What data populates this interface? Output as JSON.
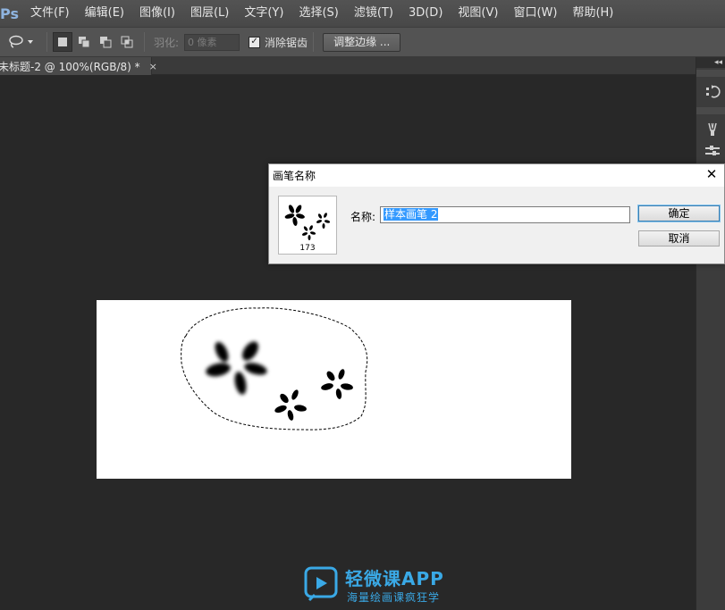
{
  "app": {
    "logo": "Ps"
  },
  "menu": [
    "文件(F)",
    "编辑(E)",
    "图像(I)",
    "图层(L)",
    "文字(Y)",
    "选择(S)",
    "滤镜(T)",
    "3D(D)",
    "视图(V)",
    "窗口(W)",
    "帮助(H)"
  ],
  "options": {
    "feather_label": "羽化:",
    "feather_value": "0 像素",
    "antialias_label": "消除锯齿",
    "antialias_checked": true,
    "refine_edge_label": "调整边缘 ..."
  },
  "document": {
    "tab_title": "未标题-2 @ 100%(RGB/8) *",
    "close": "×"
  },
  "right_panel": {
    "collapse": "◂◂"
  },
  "dialog": {
    "title": "画笔名称",
    "close": "✕",
    "name_label": "名称:",
    "name_value": "样本画笔 2",
    "preview_size": "173",
    "ok_label": "确定",
    "cancel_label": "取消"
  },
  "watermark": {
    "title": "轻微课APP",
    "subtitle": "海量绘画课疯狂学"
  },
  "colors": {
    "accent": "#3399ff",
    "watermark": "#3aa9e6",
    "workspace": "#282828",
    "chrome": "#535353"
  }
}
